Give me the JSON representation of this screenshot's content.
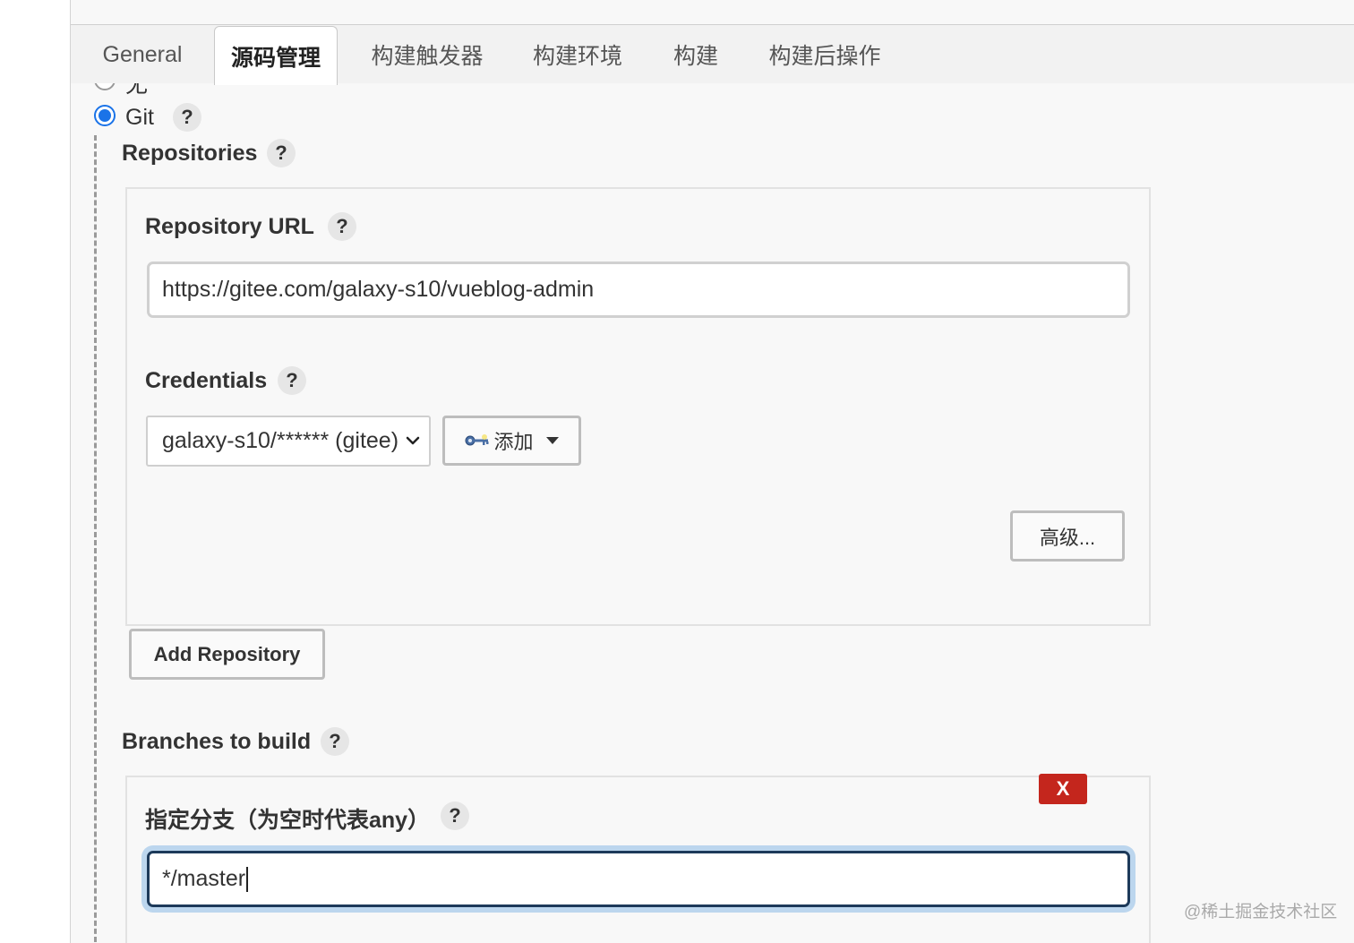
{
  "tabs": [
    {
      "label": "General",
      "active": false
    },
    {
      "label": "源码管理",
      "active": true
    },
    {
      "label": "构建触发器",
      "active": false
    },
    {
      "label": "构建环境",
      "active": false
    },
    {
      "label": "构建",
      "active": false
    },
    {
      "label": "构建后操作",
      "active": false
    }
  ],
  "scm": {
    "option_none_label": "无",
    "option_git_label": "Git",
    "selected": "Git",
    "help_symbol": "?"
  },
  "repositories": {
    "title": "Repositories",
    "url_label": "Repository URL",
    "url_value": "https://gitee.com/galaxy-s10/vueblog-admin",
    "credentials_label": "Credentials",
    "credentials_selected": "galaxy-s10/****** (gitee)",
    "add_button_label": "添加",
    "advanced_button_label": "高级...",
    "add_repository_label": "Add Repository"
  },
  "branches": {
    "title": "Branches to build",
    "branch_label": "指定分支（为空时代表any）",
    "branch_value": "*/master",
    "delete_label": "X"
  },
  "watermark": "@稀土掘金技术社区",
  "colors": {
    "accent": "#1a73e8",
    "danger": "#c4261d",
    "focus_ring": "#bcd6ee"
  }
}
